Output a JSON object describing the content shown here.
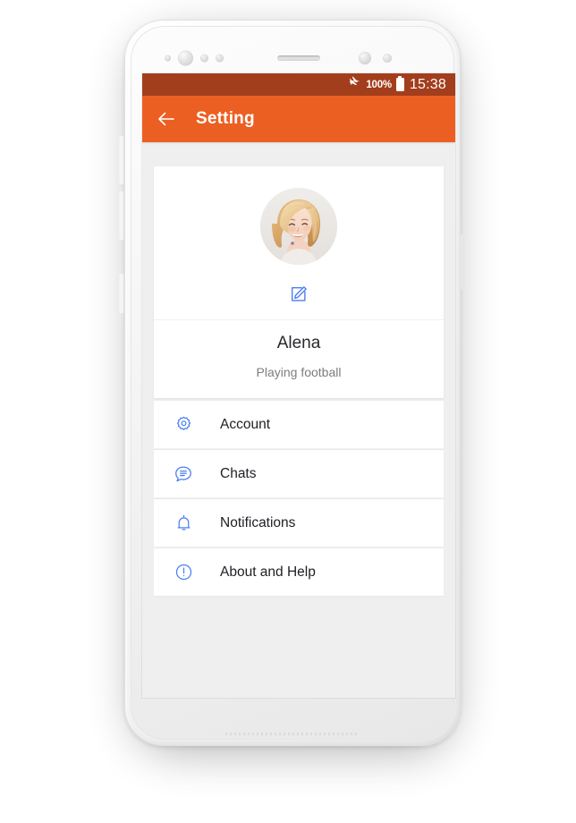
{
  "device": {
    "frame": "android-phone-white",
    "body_color": "#f3f3f3"
  },
  "status_bar": {
    "airplane_icon": "airplane-mode-icon",
    "battery_percent": "100%",
    "battery_icon": "battery-full-icon",
    "time": "15:38",
    "background": "#a33e1d",
    "foreground": "#ffffff"
  },
  "app_bar": {
    "back_icon": "arrow-left-icon",
    "title": "Setting",
    "background": "#ec5f22",
    "foreground": "#ffffff"
  },
  "profile": {
    "avatar_alt": "user-avatar-photo",
    "edit_icon": "edit-pencil-icon",
    "edit_icon_color": "#4a7ef0",
    "name": "Alena",
    "status": "Playing football"
  },
  "menu": {
    "icon_color": "#4a7ef0",
    "items": [
      {
        "label": "Account",
        "icon": "gear-icon"
      },
      {
        "label": "Chats",
        "icon": "chat-bubble-icon"
      },
      {
        "label": "Notifications",
        "icon": "bell-icon"
      },
      {
        "label": "About and Help",
        "icon": "info-exclamation-icon"
      }
    ]
  },
  "theme": {
    "page_background": "#efefef",
    "card_background": "#ffffff",
    "accent": "#ec5f22",
    "text_primary": "#1d1f23",
    "text_secondary": "#7b7d80"
  }
}
